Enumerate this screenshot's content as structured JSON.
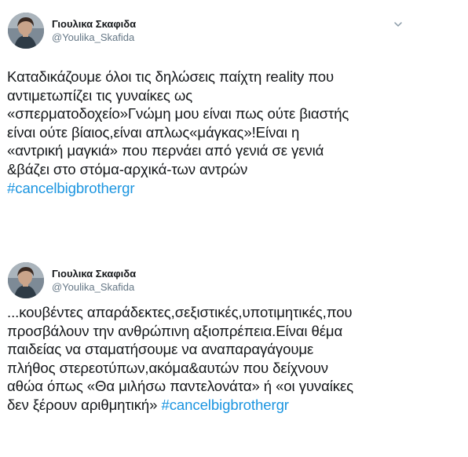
{
  "tweets": [
    {
      "author_name": "Γιουλικα Σκαφιδα",
      "author_handle": "@Youlika_Skafida",
      "text": "Καταδικάζουμε όλοι τις δηλώσεις παίχτη reality που\nαντιμετωπίζει τις γυναίκες ως\n«σπερματοδοχείο»Γνώμη μου είναι πως ούτε  βιαστής\nείναι ούτε βίαιος,είναι απλως«μάγκας»!Είναι η\n«αντρική μαγκιά» που περνάει από γενιά σε γενιά\n&βάζει στο στόμα-αρχικά-των αντρών\n",
      "hashtag": "#cancelbigbrothergr"
    },
    {
      "author_name": "Γιουλικα Σκαφιδα",
      "author_handle": "@Youlika_Skafida",
      "text": "...κουβέντες απαράδεκτες,σεξιστικές,υποτιμητικές,που\nπροσβάλουν την ανθρώπινη αξιοπρέπεια.Είναι θέμα\nπαιδείας να σταματήσουμε να αναπαραγάγουμε\nπλήθος στερεοτύπων,ακόμα&αυτών που δείχνουν\nαθώα όπως «Θα μιλήσω παντελονάτα» ή «οι γυναίκες\nδεν ξέρουν αριθμητική» ",
      "hashtag": "#cancelbigbrothergr"
    }
  ],
  "icons": {
    "avatar": "profile-photo",
    "menu": "chevron-down-icon"
  },
  "colors": {
    "text": "#14171a",
    "secondary": "#657786",
    "link": "#1b95e0"
  }
}
